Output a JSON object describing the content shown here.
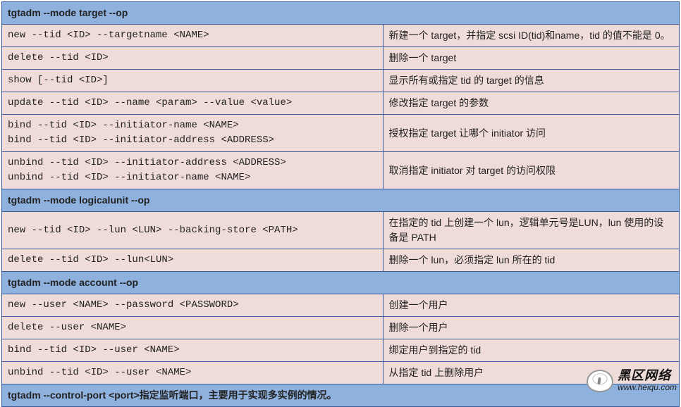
{
  "sections": [
    {
      "header": "tgtadm --mode target --op",
      "rows": [
        {
          "cmd": "new --tid <ID> --targetname <NAME>",
          "desc": "新建一个 target，并指定 scsi ID(tid)和name，tid 的值不能是 0。"
        },
        {
          "cmd": "delete --tid <ID>",
          "desc": "删除一个 target"
        },
        {
          "cmd": "show [--tid <ID>]",
          "desc": "显示所有或指定 tid 的 target 的信息"
        },
        {
          "cmd": "update --tid <ID> --name <param> --value <value>",
          "desc": "修改指定 target 的参数"
        },
        {
          "cmd": "bind --tid <ID> --initiator-name <NAME>\nbind --tid <ID> --initiator-address <ADDRESS>",
          "desc": "授权指定 target 让哪个 initiator 访问"
        },
        {
          "cmd": "unbind --tid <ID> --initiator-address <ADDRESS>\nunbind --tid <ID> --initiator-name <NAME>",
          "desc": "取消指定 initiator 对 target 的访问权限"
        }
      ]
    },
    {
      "header": "tgtadm --mode logicalunit --op",
      "rows": [
        {
          "cmd": "new --tid <ID> --lun <LUN> --backing-store <PATH>",
          "desc": "在指定的 tid 上创建一个 lun，逻辑单元号是LUN，lun 使用的设备是 PATH"
        },
        {
          "cmd": "delete --tid <ID> --lun<LUN>",
          "desc": "删除一个 lun，必须指定 lun 所在的 tid"
        }
      ]
    },
    {
      "header": "tgtadm --mode account --op",
      "rows": [
        {
          "cmd": "new --user <NAME> --password <PASSWORD>",
          "desc": "创建一个用户"
        },
        {
          "cmd": "delete --user <NAME>",
          "desc": "删除一个用户"
        },
        {
          "cmd": "bind --tid <ID> --user <NAME>",
          "desc": "绑定用户到指定的 tid"
        },
        {
          "cmd": "unbind --tid <ID> --user <NAME>",
          "desc": "从指定 tid 上删除用户"
        }
      ]
    }
  ],
  "footer": "tgtadm --control-port <port>指定监听端口，主要用于实现多实例的情况。",
  "watermark": {
    "brand": "黑区网络",
    "url": "www.heiqu.com"
  }
}
